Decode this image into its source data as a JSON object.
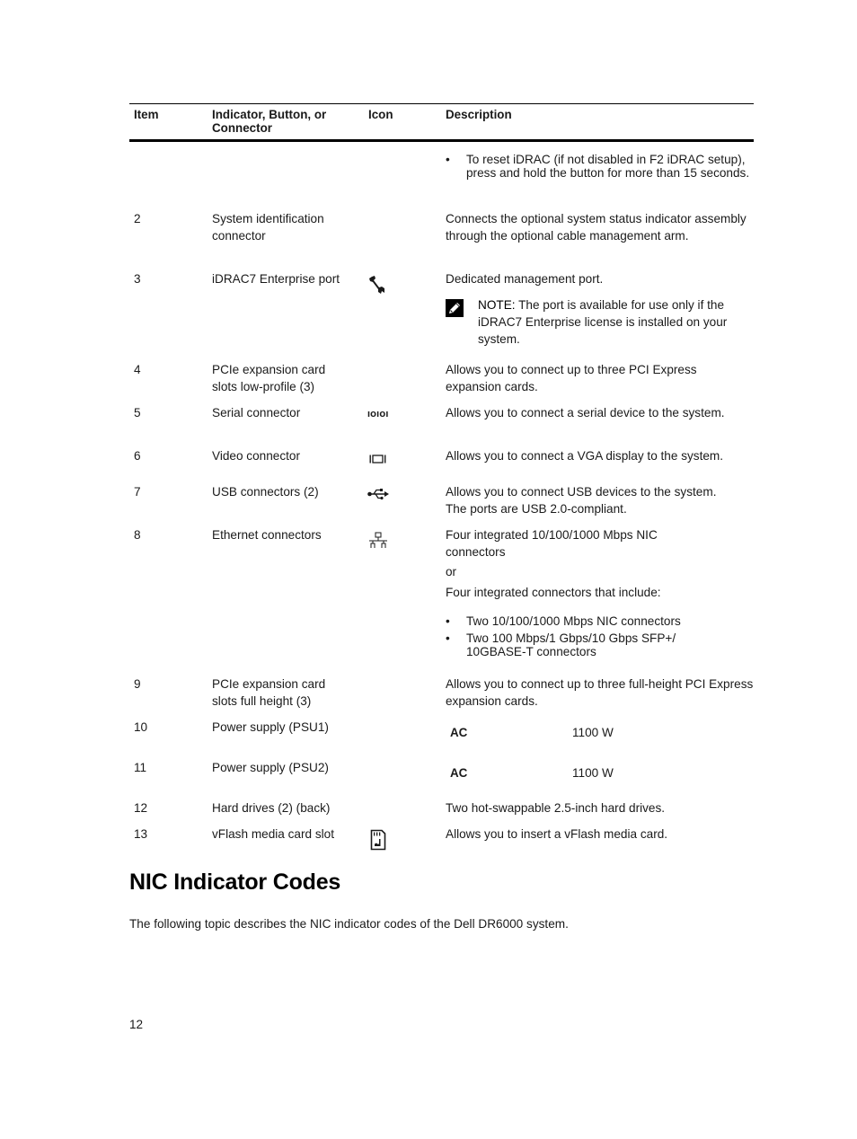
{
  "table": {
    "headers": {
      "item": "Item",
      "name": "Indicator, Button, or Connector",
      "icon": "Icon",
      "description": "Description"
    },
    "continued_row": {
      "bullets": [
        "To reset iDRAC (if not disabled in F2 iDRAC setup), press and hold the button for more than 15 seconds."
      ]
    },
    "rows": [
      {
        "item": "2",
        "name": "System identification connector",
        "icon": "",
        "description": "Connects the optional system status indicator assembly through the optional cable management arm."
      },
      {
        "item": "3",
        "name": "iDRAC7 Enterprise port",
        "icon": "wrench-icon",
        "description": "Dedicated management port.",
        "note_label": "NOTE:",
        "note_text": " The port is available for use only if the iDRAC7 Enterprise license is installed on your system."
      },
      {
        "item": "4",
        "name": "PCIe expansion card slots low-profile (3)",
        "icon": "",
        "description": "Allows you to connect up to three PCI Express expansion cards."
      },
      {
        "item": "5",
        "name": "Serial connector",
        "icon": "serial-icon",
        "icon_glyph": "IOIOI",
        "description": "Allows you to connect a serial device to the system."
      },
      {
        "item": "6",
        "name": "Video connector",
        "icon": "video-icon",
        "description": "Allows you to connect a VGA display to the system."
      },
      {
        "item": "7",
        "name": "USB connectors (2)",
        "icon": "usb-icon",
        "description_lines": [
          "Allows you to connect USB devices to the system.",
          "The ports are USB 2.0-compliant."
        ]
      },
      {
        "item": "8",
        "name": "Ethernet connectors",
        "icon": "ethernet-icon",
        "description_paragraphs": [
          "Four integrated 10/100/1000 Mbps NIC connectors",
          "or",
          "Four integrated connectors that include:"
        ],
        "bullets": [
          "Two 10/100/1000 Mbps NIC connectors",
          "Two 100 Mbps/1 Gbps/10 Gbps SFP+/ 10GBASE-T connectors"
        ]
      },
      {
        "item": "9",
        "name": "PCIe expansion card slots full height (3)",
        "icon": "",
        "description": "Allows you to connect up to three full-height PCI Express expansion cards."
      },
      {
        "item": "10",
        "name": "Power supply (PSU1)",
        "icon": "",
        "psu_type": "AC",
        "psu_watt": "1100 W"
      },
      {
        "item": "11",
        "name": "Power supply (PSU2)",
        "icon": "",
        "psu_type": "AC",
        "psu_watt": "1100 W"
      },
      {
        "item": "12",
        "name": "Hard drives (2) (back)",
        "icon": "",
        "description": "Two hot-swappable 2.5-inch hard drives."
      },
      {
        "item": "13",
        "name": "vFlash media card slot",
        "icon": "sd-card-icon",
        "description": "Allows you to insert a vFlash media card."
      }
    ]
  },
  "section": {
    "title": "NIC Indicator Codes",
    "body": "The following topic describes the NIC indicator codes of the Dell DR6000 system."
  },
  "footer": {
    "page_number": "12"
  }
}
